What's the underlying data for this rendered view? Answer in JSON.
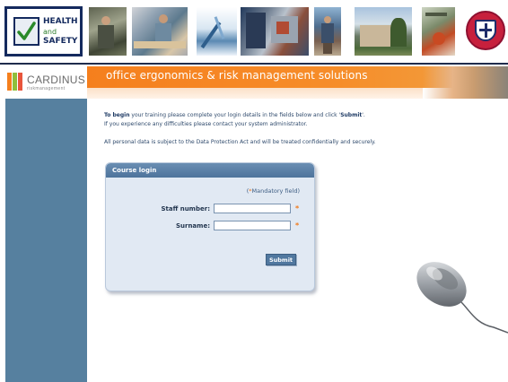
{
  "header": {
    "hs_logo": {
      "line1": "HEALTH",
      "line2": "and",
      "line3": "SAFETY"
    },
    "photos": [
      "photo-office-worker",
      "photo-desk-meeting",
      "photo-lab",
      "photo-workshop",
      "photo-hiker",
      "photo-building",
      "photo-equipment"
    ],
    "crest_text": "THE UNIVERSITY OF EDINBURGH"
  },
  "brand": {
    "name": "CARDINUS",
    "sub": "riskmanagement",
    "tagline": "office ergonomics & risk management solutions",
    "bar_colors": [
      "#f57f1d",
      "#8fbf3c",
      "#e8553c"
    ]
  },
  "intro": {
    "line1_bold": "To begin",
    "line1_text": " your training please complete your login details in the fields below and click '",
    "line1_submit": "Submit",
    "line1_end": "'.",
    "line2": "If you experience any difficulties please contact your system administrator.",
    "line3": "All personal data is subject to the Data Protection Act and will be treated confidentially and securely."
  },
  "login": {
    "title": "Course login",
    "mandatory_open": "(",
    "mandatory_star": "*",
    "mandatory_text": "Mandatory field)",
    "staff_label": "Staff number:",
    "staff_value": "",
    "surname_label": "Surname:",
    "surname_value": "",
    "required_mark": "*",
    "submit_label": "Submit"
  },
  "colors": {
    "orange": "#f57f1d",
    "sidebar_blue": "#56809f",
    "panel_blue": "#e1e9f3",
    "header_navy": "#142a5e"
  }
}
